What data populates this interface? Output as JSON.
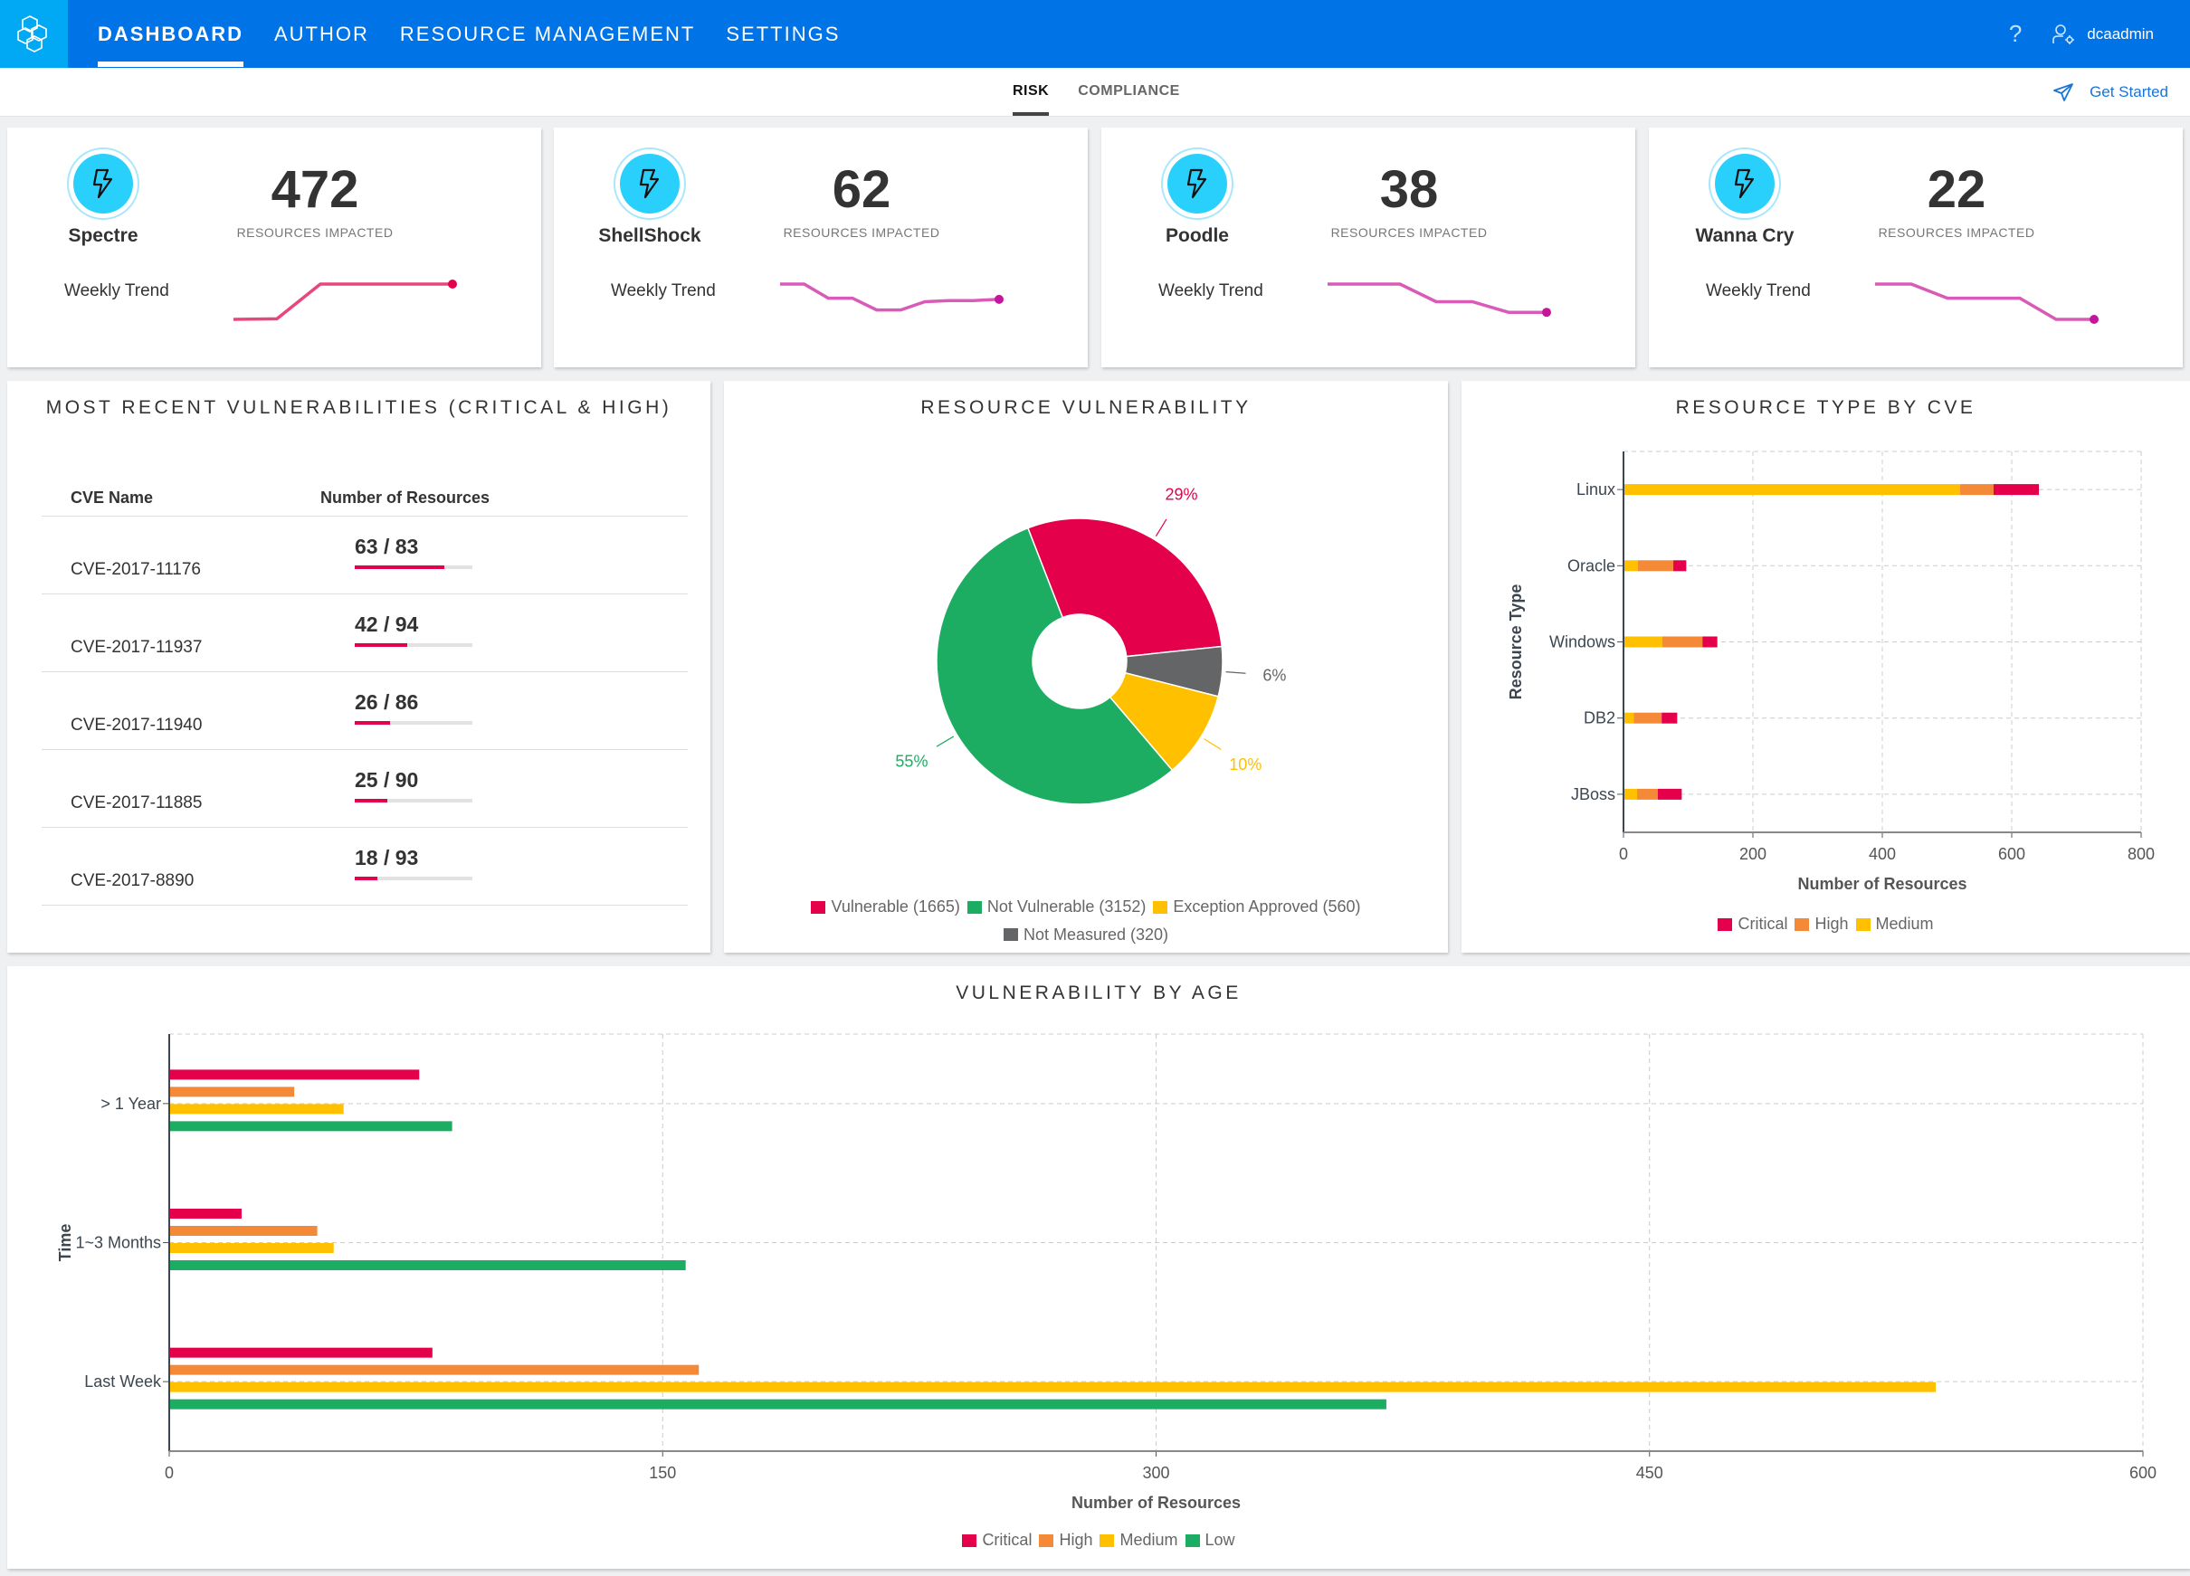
{
  "nav": {
    "items": [
      {
        "label": "DASHBOARD",
        "active": true
      },
      {
        "label": "AUTHOR",
        "active": false
      },
      {
        "label": "RESOURCE MANAGEMENT",
        "active": false
      },
      {
        "label": "SETTINGS",
        "active": false
      }
    ],
    "help_label": "?",
    "username": "dcaadmin"
  },
  "subnav": {
    "tabs": [
      {
        "label": "RISK",
        "active": true
      },
      {
        "label": "COMPLIANCE",
        "active": false
      }
    ],
    "get_started": "Get Started"
  },
  "kpis": [
    {
      "name": "Spectre",
      "count": "472",
      "count_label": "RESOURCES IMPACTED",
      "trend_label": "Weekly Trend",
      "trend": [
        10,
        10.5,
        40,
        40,
        40,
        40
      ],
      "trend_color": "#e8467c",
      "end_color": "#e5004c"
    },
    {
      "name": "ShellShock",
      "count": "62",
      "count_label": "RESOURCES IMPACTED",
      "trend_label": "Weekly Trend",
      "trend": [
        40,
        40,
        28,
        28,
        18,
        18,
        25,
        26,
        26,
        27
      ],
      "trend_color": "#d95bb8",
      "end_color": "#c4169a"
    },
    {
      "name": "Poodle",
      "count": "38",
      "count_label": "RESOURCES IMPACTED",
      "trend_label": "Weekly Trend",
      "trend": [
        40,
        40,
        40,
        25,
        25,
        16,
        16
      ],
      "trend_color": "#d95bb8",
      "end_color": "#c4169a"
    },
    {
      "name": "Wanna Cry",
      "count": "22",
      "count_label": "RESOURCES IMPACTED",
      "trend_label": "Weekly Trend",
      "trend": [
        40,
        40,
        28,
        28,
        28,
        10,
        10
      ],
      "trend_color": "#d95bb8",
      "end_color": "#c4169a"
    }
  ],
  "recent_vulns": {
    "title": "MOST RECENT VULNERABILITIES (CRITICAL & HIGH)",
    "columns": [
      "CVE Name",
      "Number of Resources"
    ],
    "rows": [
      {
        "cve": "CVE-2017-11176",
        "affected": 63,
        "total": 83,
        "label": "63 / 83"
      },
      {
        "cve": "CVE-2017-11937",
        "affected": 42,
        "total": 94,
        "label": "42 / 94"
      },
      {
        "cve": "CVE-2017-11940",
        "affected": 26,
        "total": 86,
        "label": "26 / 86"
      },
      {
        "cve": "CVE-2017-11885",
        "affected": 25,
        "total": 90,
        "label": "25 / 90"
      },
      {
        "cve": "CVE-2017-8890",
        "affected": 18,
        "total": 93,
        "label": "18 / 93"
      }
    ]
  },
  "colors": {
    "critical": "#e5004c",
    "high": "#f48a37",
    "medium": "#ffc000",
    "low": "#1cad62",
    "not_measured": "#646567"
  },
  "chart_data": [
    {
      "type": "pie",
      "title": "RESOURCE VULNERABILITY",
      "donut": true,
      "slices": [
        {
          "label": "Vulnerable",
          "value": 1665,
          "percent_label": "29%",
          "color": "#e5004c",
          "legend": "Vulnerable (1665)"
        },
        {
          "label": "Not Measured",
          "value": 320,
          "percent_label": "6%",
          "color": "#646567",
          "legend": "Not Measured (320)"
        },
        {
          "label": "Exception Approved",
          "value": 560,
          "percent_label": "10%",
          "color": "#ffc000",
          "legend": "Exception Approved (560)"
        },
        {
          "label": "Not Vulnerable",
          "value": 3152,
          "percent_label": "55%",
          "color": "#1cad62",
          "legend": "Not Vulnerable (3152)"
        }
      ],
      "legend_order": [
        "Vulnerable",
        "Not Vulnerable",
        "Exception Approved",
        "Not Measured"
      ],
      "legend_position": "bottom"
    },
    {
      "type": "bar",
      "orientation": "horizontal",
      "stacked": true,
      "title": "RESOURCE TYPE BY CVE",
      "xlabel": "Number of Resources",
      "ylabel": "Resource Type",
      "categories": [
        "Linux",
        "Oracle",
        "Windows",
        "DB2",
        "JBoss"
      ],
      "series": [
        {
          "name": "Medium",
          "color": "#ffc000",
          "values": [
            520,
            22,
            60,
            16,
            21
          ]
        },
        {
          "name": "High",
          "color": "#f48a37",
          "values": [
            52,
            55,
            62,
            43,
            32
          ]
        },
        {
          "name": "Critical",
          "color": "#e5004c",
          "values": [
            70,
            20,
            23,
            24,
            37
          ]
        }
      ],
      "legend": [
        "Critical",
        "High",
        "Medium"
      ],
      "xlim": [
        0,
        800
      ],
      "xticks": [
        0,
        200,
        400,
        600,
        800
      ],
      "grid": true,
      "legend_position": "bottom"
    },
    {
      "type": "bar",
      "orientation": "horizontal",
      "stacked": false,
      "title": "VULNERABILITY BY AGE",
      "xlabel": "Number of Resources",
      "ylabel": "Time",
      "categories": [
        "> 1 Year",
        "1~3 Months",
        "Last Week"
      ],
      "series": [
        {
          "name": "Critical",
          "color": "#e5004c",
          "values": [
            76,
            22,
            80
          ]
        },
        {
          "name": "High",
          "color": "#f48a37",
          "values": [
            38,
            45,
            161
          ]
        },
        {
          "name": "Medium",
          "color": "#ffc000",
          "values": [
            53,
            50,
            537
          ]
        },
        {
          "name": "Low",
          "color": "#1cad62",
          "values": [
            86,
            157,
            370
          ]
        }
      ],
      "xlim": [
        0,
        600
      ],
      "xticks": [
        0,
        150,
        300,
        450,
        600
      ],
      "grid": true,
      "legend_position": "bottom"
    }
  ]
}
